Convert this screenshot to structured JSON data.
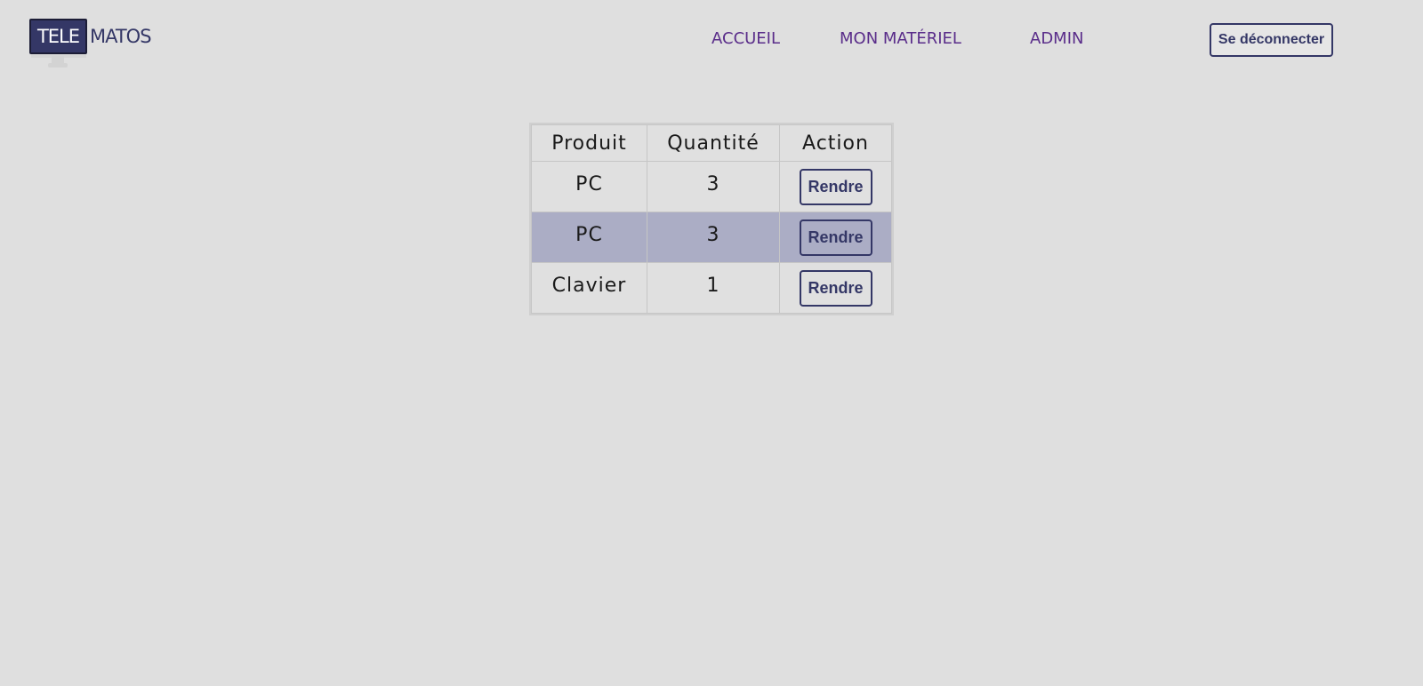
{
  "header": {
    "logo": {
      "part1": "TELE",
      "part2": "MATOS"
    },
    "nav": {
      "accueil": "ACCUEIL",
      "materiel": "MON MATÉRIEL",
      "admin": "ADMIN"
    },
    "logout_label": "Se déconnecter"
  },
  "table": {
    "headers": {
      "produit": "Produit",
      "quantite": "Quantité",
      "action": "Action"
    },
    "rows": [
      {
        "produit": "PC",
        "quantite": "3",
        "action_label": "Rendre",
        "highlighted": false
      },
      {
        "produit": "PC",
        "quantite": "3",
        "action_label": "Rendre",
        "highlighted": true
      },
      {
        "produit": "Clavier",
        "quantite": "1",
        "action_label": "Rendre",
        "highlighted": false
      }
    ]
  },
  "colors": {
    "background": "#dfdfdf",
    "brand": "#343766",
    "nav_link": "#5a2d8a",
    "row_highlight": "#abadc5"
  }
}
